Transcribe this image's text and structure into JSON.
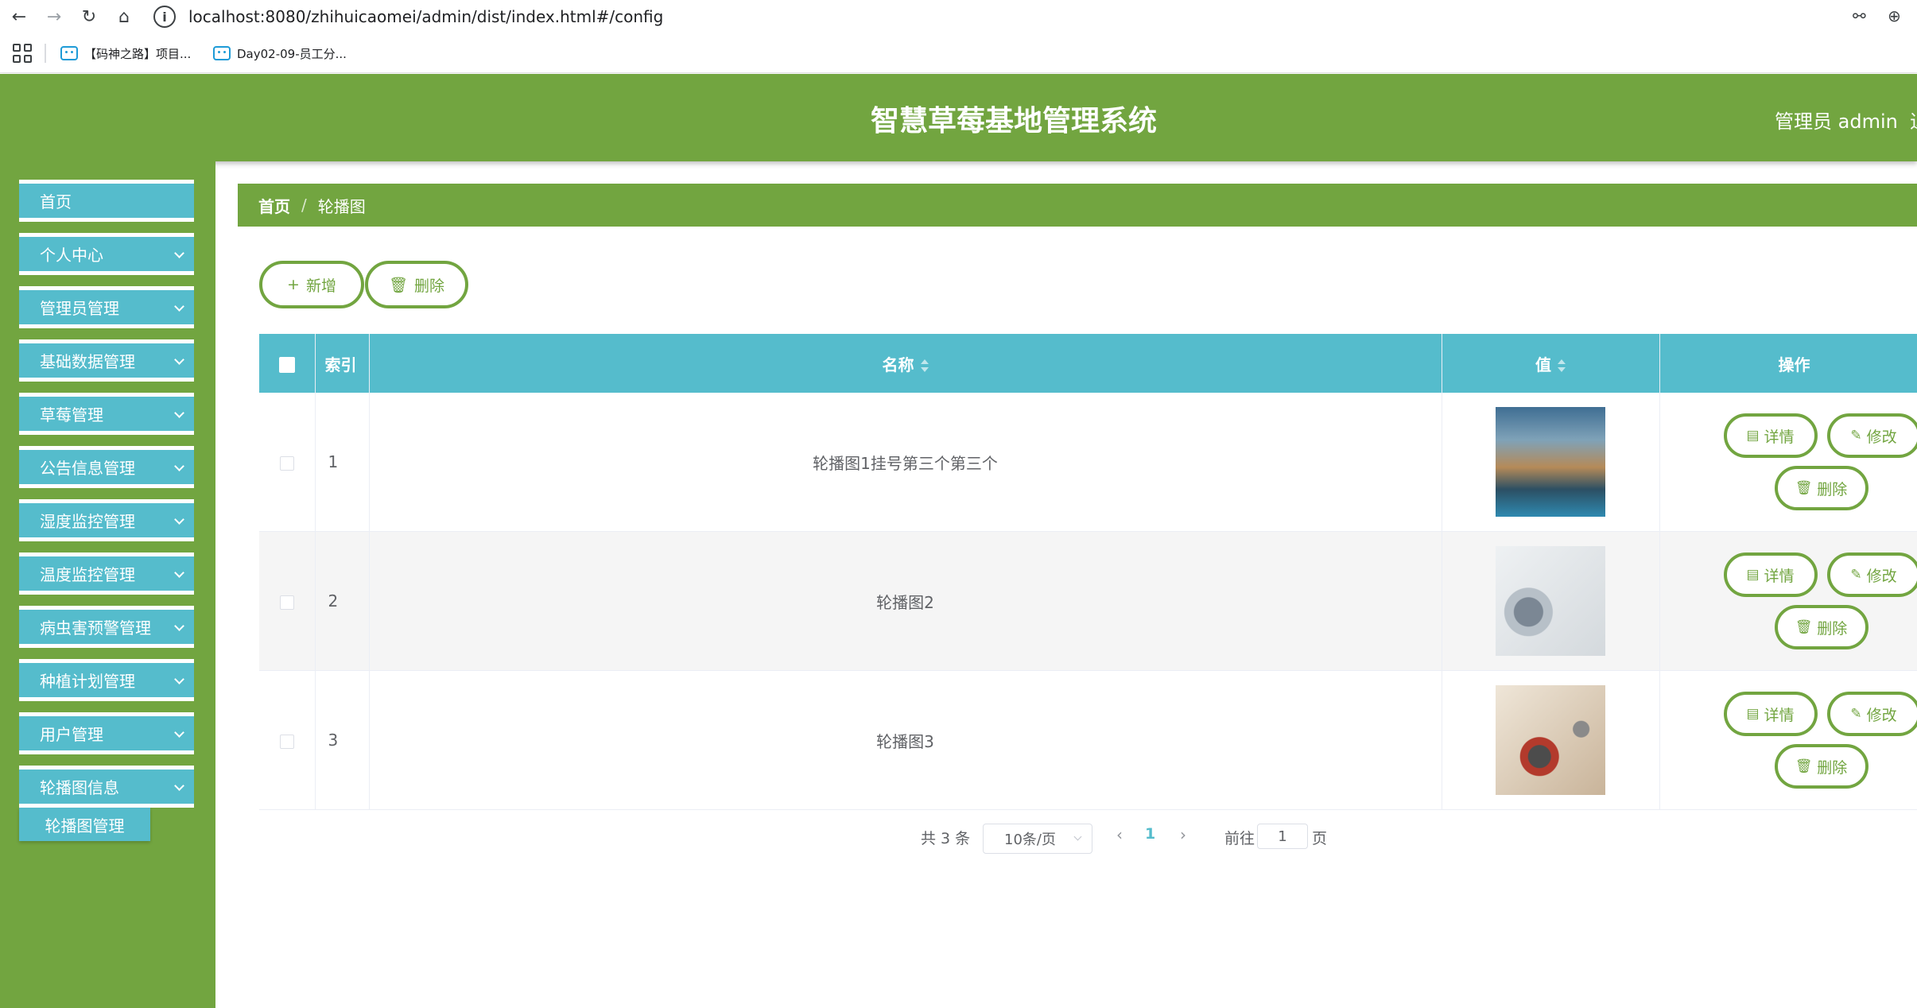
{
  "browser": {
    "url": "localhost:8080/zhihuicaomei/admin/dist/index.html#/config",
    "bookmarks": [
      {
        "label": "【码神之路】项目..."
      },
      {
        "label": "Day02-09-员工分..."
      }
    ]
  },
  "header": {
    "title": "智慧草莓基地管理系统",
    "user": "管理员 admin",
    "logout": "退出登录"
  },
  "sidebar": {
    "items": [
      {
        "label": "首页"
      },
      {
        "label": "个人中心"
      },
      {
        "label": "管理员管理"
      },
      {
        "label": "基础数据管理"
      },
      {
        "label": "草莓管理"
      },
      {
        "label": "公告信息管理"
      },
      {
        "label": "湿度监控管理"
      },
      {
        "label": "温度监控管理"
      },
      {
        "label": "病虫害预警管理"
      },
      {
        "label": "种植计划管理"
      },
      {
        "label": "用户管理"
      },
      {
        "label": "轮播图信息"
      }
    ],
    "submenu": {
      "label": "轮播图管理"
    }
  },
  "breadcrumb": {
    "home": "首页",
    "sep": "/",
    "current": "轮播图"
  },
  "toolbar": {
    "add_label": "新增",
    "delete_label": "删除"
  },
  "table": {
    "headers": {
      "index": "索引",
      "name": "名称",
      "value": "值",
      "actions": "操作"
    },
    "rows": [
      {
        "index": "1",
        "name": "轮播图1挂号第三个第三个"
      },
      {
        "index": "2",
        "name": "轮播图2"
      },
      {
        "index": "3",
        "name": "轮播图3"
      }
    ],
    "actions": {
      "detail": "详情",
      "edit": "修改",
      "delete": "删除"
    }
  },
  "pagination": {
    "total": "共 3 条",
    "page_size": "10条/页",
    "current_page": "1",
    "goto_prefix": "前往",
    "goto_value": "1",
    "goto_suffix": "页"
  },
  "colors": {
    "header_green": "#72a540",
    "menu_teal": "#55bccc"
  }
}
